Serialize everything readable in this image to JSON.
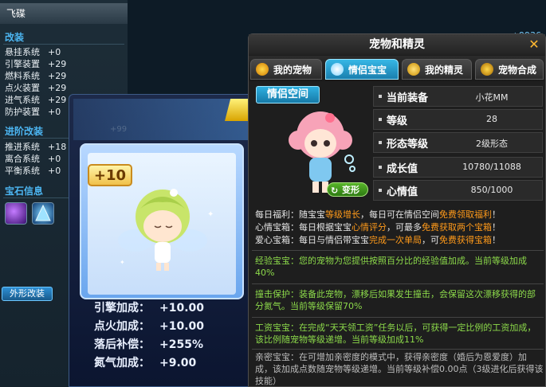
{
  "left_panel": {
    "title": "飞碟",
    "modification": {
      "heading": "改装",
      "total": "+9936",
      "rows": [
        {
          "label": "悬挂系统",
          "value": "+0"
        },
        {
          "label": "引擎装置",
          "value": "+29"
        },
        {
          "label": "燃料系统",
          "value": "+29"
        },
        {
          "label": "点火装置",
          "value": "+29"
        },
        {
          "label": "进气系统",
          "value": "+29"
        },
        {
          "label": "防护装置",
          "value": "+0"
        }
      ]
    },
    "advanced": {
      "heading": "进阶改装",
      "rows": [
        {
          "label": "推进系统",
          "value": "+18"
        },
        {
          "label": "离合系统",
          "value": "+0"
        },
        {
          "label": "平衡系统",
          "value": "+0"
        }
      ]
    },
    "gems": {
      "heading": "宝石信息"
    },
    "appearance_button": "外形改装"
  },
  "pet_card": {
    "faded_number": "+99",
    "level_badge": "+10",
    "stats": [
      {
        "label": "引擎加成：",
        "value": "+10.00"
      },
      {
        "label": "点火加成：",
        "value": "+10.00"
      },
      {
        "label": "落后补偿：",
        "value": "+255%"
      },
      {
        "label": "氮气加成：",
        "value": "+9.00"
      }
    ]
  },
  "dialog": {
    "title": "宠物和精灵",
    "close_glyph": "✕",
    "tabs": [
      {
        "label": "我的宠物",
        "active": false
      },
      {
        "label": "情侣宝宝",
        "active": true
      },
      {
        "label": "我的精灵",
        "active": false
      },
      {
        "label": "宠物合成",
        "active": false
      }
    ],
    "space_label": "情侣空间",
    "transform_button": "变形",
    "info": [
      {
        "key": "当前装备",
        "value": "小花MM"
      },
      {
        "key": "等级",
        "value": "28"
      },
      {
        "key": "形态等级",
        "value": "2级形态"
      },
      {
        "key": "成长值",
        "value": "10780/11088"
      },
      {
        "key": "心情值",
        "value": "850/1000"
      }
    ],
    "benefits": {
      "daily_1": "每日福利：随宝宝",
      "daily_2": "等级增长",
      "daily_3": "，每日可在情侣空间",
      "daily_4": "免费领取福利",
      "daily_5": "！",
      "mood_1": "心情宝箱：每日根据宝宝",
      "mood_2": "心情评分",
      "mood_3": "，可最多",
      "mood_4": "免费获取两个宝箱",
      "mood_5": "！",
      "love_1": "爱心宝箱：每日与情侣带宝宝",
      "love_2": "完成一次单局",
      "love_3": "，可",
      "love_4": "免费获得宝箱",
      "love_5": "！"
    },
    "skills": {
      "exp": "经验宝宝：您的宠物为您提供按照百分比的经验值加成。当前等级加成40%",
      "collision": "撞击保护：装备此宠物，漂移后如果发生撞击，会保留这次漂移获得的部分氮气。当前等级保留70%",
      "salary": "工资宝宝：在完成“天天领工资”任务以后，可获得一定比例的工资加成，该比例随宠物等级递增。当前等级加成11%",
      "intimacy": "亲密宝宝：在可增加亲密度的模式中，获得亲密度（婚后为恩爱度）加成，该加成点数随宠物等级递增。当前等级补偿0.00点（3级进化后获得该技能）"
    }
  }
}
